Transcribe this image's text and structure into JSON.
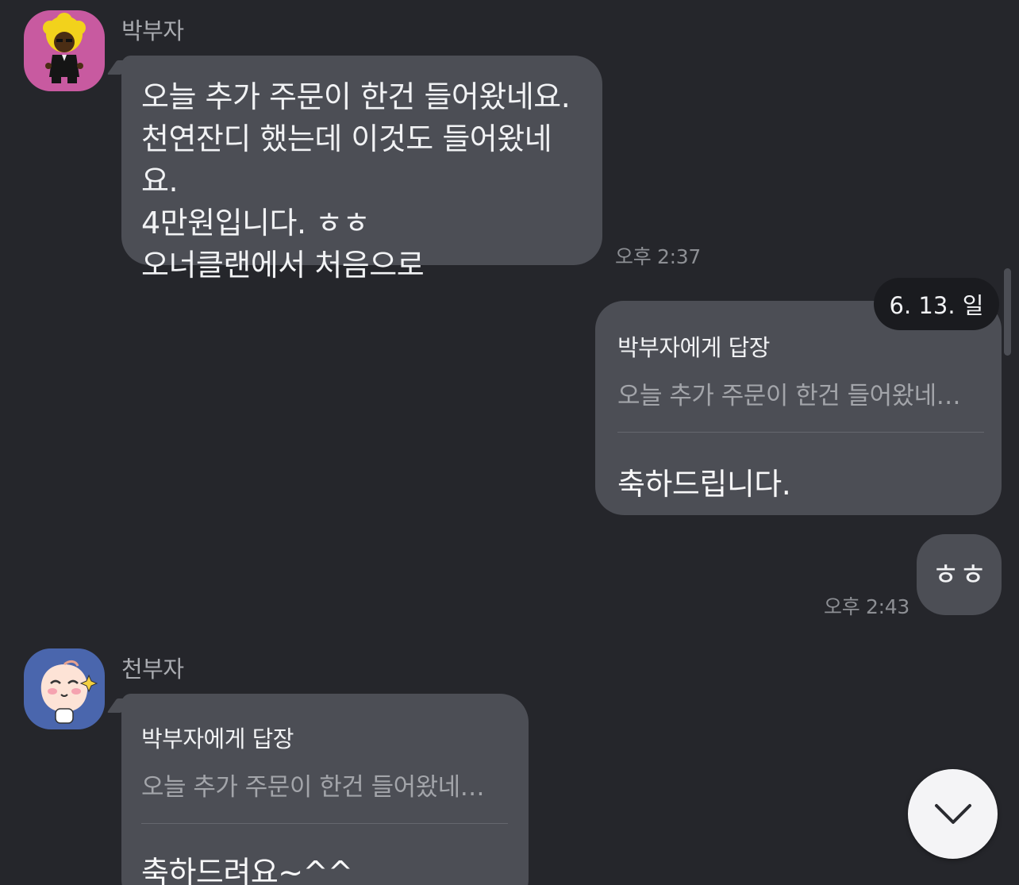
{
  "colors": {
    "background": "#25262b",
    "bubble": "#4c4e55",
    "text": "#f1f2f4",
    "muted_text": "#8d8f94",
    "date_chip": "#1a1b1f",
    "avatar1_bg": "#c85aa0",
    "avatar2_bg": "#4a66ad"
  },
  "messages": [
    {
      "sender": "박부자",
      "avatar_icon": "afro-character-avatar",
      "text": "오늘 추가 주문이 한건 들어왔네요.\n천연잔디 했는데 이것도 들어왔네요.\n4만원입니다. ㅎㅎ\n오너클랜에서 처음으로",
      "time": "오후 2:37"
    },
    {
      "date_chip": "6. 13. 일",
      "reply_title": "박부자에게 답장",
      "reply_quote": "오늘 추가 주문이 한건 들어왔네…",
      "text": "축하드립니다."
    },
    {
      "text": "ㅎㅎ",
      "time": "오후 2:43"
    },
    {
      "sender": "천부자",
      "avatar_icon": "peach-character-avatar",
      "reply_title": "박부자에게 답장",
      "reply_quote": "오늘 추가 주문이 한건 들어왔네…",
      "text": "축하드려요~^^"
    }
  ],
  "scroll_down_icon": "chevron-down-icon"
}
